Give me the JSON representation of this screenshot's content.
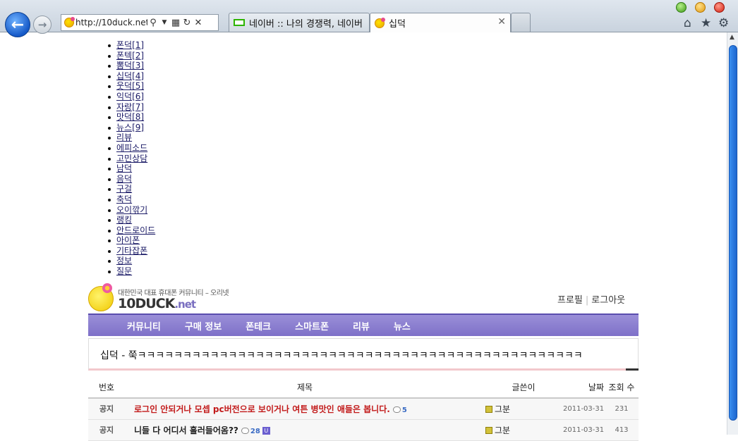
{
  "browser": {
    "address_url": "http://10duck.net/?",
    "tabs": [
      {
        "label": "네이버 :: 나의 경쟁력, 네이버"
      },
      {
        "label": "십덕"
      }
    ],
    "close_glyph": "✕"
  },
  "menu": [
    {
      "label": "폰덕[1]"
    },
    {
      "label": "폰텍[2]"
    },
    {
      "label": "뽐덕[3]"
    },
    {
      "label": "십덕[4]"
    },
    {
      "label": "웃덕[5]"
    },
    {
      "label": "익덕[6]"
    },
    {
      "label": "자랑[7]"
    },
    {
      "label": "맛덕[8]"
    },
    {
      "label": "뉴스[9]"
    },
    {
      "label": "리뷰"
    },
    {
      "label": "에피소드"
    },
    {
      "label": "고민상담"
    },
    {
      "label": "남덕"
    },
    {
      "label": "음덕"
    },
    {
      "label": "구걸"
    },
    {
      "label": "축덕"
    },
    {
      "label": "오이깎기"
    },
    {
      "label": "랭킹"
    },
    {
      "label": "안드로이드"
    },
    {
      "label": "아이폰"
    },
    {
      "label": "기타잡폰"
    },
    {
      "label": "정보"
    },
    {
      "label": "질문"
    }
  ],
  "site": {
    "tagline": "대한민국 대표 휴대폰 커뮤니티 – 오리넷",
    "logo_main": "10DUCK",
    "logo_suffix": ".net",
    "profile_label": "프로필",
    "separator": "|",
    "logout_label": "로그아웃",
    "gnb": [
      {
        "label": "커뮤니티"
      },
      {
        "label": "구매 정보"
      },
      {
        "label": "폰테크"
      },
      {
        "label": "스마트폰"
      },
      {
        "label": "리뷰"
      },
      {
        "label": "뉴스"
      }
    ]
  },
  "board": {
    "title": "십덕 - 쭉ㅋㅋㅋㅋㅋㅋㅋㅋㅋㅋㅋㅋㅋㅋㅋㅋㅋㅋㅋㅋㅋㅋㅋㅋㅋㅋㅋㅋㅋㅋㅋㅋㅋㅋㅋㅋㅋㅋㅋㅋㅋㅋㅋㅋㅋㅋㅋㅋㅋ",
    "columns": {
      "num": "번호",
      "subject": "제목",
      "writer": "글쓴이",
      "date": "날짜",
      "views": "조회 수"
    },
    "rows": [
      {
        "num": "공지",
        "subject": "로그인 안되거나 모셉 pc버전으로 보이거나 여튼 병맛인 애들은 봅니다.",
        "comments": "5",
        "new_badge": "",
        "writer": "그분",
        "date": "2011-03-31",
        "views": "231"
      },
      {
        "num": "공지",
        "subject": "니들 다 어디서 흘러들어옴??",
        "comments": "28",
        "new_badge": "U",
        "writer": "그분",
        "date": "2011-03-31",
        "views": "413"
      }
    ]
  }
}
